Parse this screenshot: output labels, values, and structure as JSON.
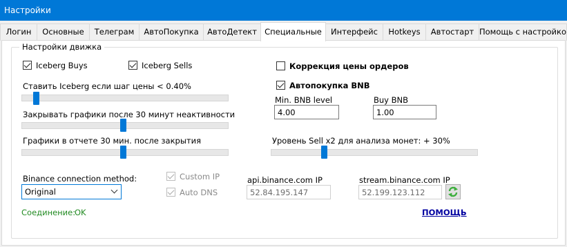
{
  "window": {
    "title": "Настройки"
  },
  "tabs": [
    {
      "label": "Логин"
    },
    {
      "label": "Основные"
    },
    {
      "label": "Телеграм"
    },
    {
      "label": "АвтоПокупка"
    },
    {
      "label": "АвтоДетект"
    },
    {
      "label": "Специальные"
    },
    {
      "label": "Интерфейс"
    },
    {
      "label": "Hotkeys"
    },
    {
      "label": "Автостарт"
    },
    {
      "label": "Помощь с настройкой"
    }
  ],
  "active_tab": "Специальные",
  "engine": {
    "group_title": "Настройки движка",
    "iceberg_buys": {
      "label": "Iceberg Buys",
      "checked": true
    },
    "iceberg_sells": {
      "label": "Iceberg Sells",
      "checked": true
    },
    "slider_iceberg": {
      "label": "Ставить Iceberg если шаг цены < 0.40%",
      "value_fraction": 0.06
    },
    "slider_close_charts": {
      "label": "Закрывать графики после 30 минут неактивности",
      "value_fraction": 0.49
    },
    "slider_report_charts": {
      "label": "Графики в отчете 30 мин. после закрытия",
      "value_fraction": 0.49
    },
    "price_correction": {
      "label": "Коррекция цены ордеров",
      "checked": false
    },
    "auto_buy_bnb": {
      "label": "Автопокупка BNB",
      "checked": true
    },
    "min_bnb": {
      "label": "Min. BNB level",
      "value": "4.00"
    },
    "buy_bnb": {
      "label": "Buy BNB",
      "value": "1.00"
    },
    "slider_sell_level": {
      "label": "Уровень Sell x2 для анализа монет: + 30%",
      "value_fraction": 0.25
    },
    "connection": {
      "label": "Binance connection method:",
      "selected": "Original",
      "custom_ip": {
        "label": "Custom IP",
        "checked": true
      },
      "auto_dns": {
        "label": "Auto DNS",
        "checked": true
      },
      "api_ip_label": "api.binance.com IP",
      "api_ip_value": "52.84.195.147",
      "stream_ip_label": "stream.binance.com IP",
      "stream_ip_value": "52.199.123.112"
    },
    "status": {
      "label": "Соединение:",
      "value": "OK"
    },
    "help_link": "ПОМОЩЬ"
  },
  "colors": {
    "titlebar": "#0078d7",
    "slider_thumb": "#0078d7",
    "status_ok": "#228b22",
    "help_link": "#0000a0",
    "refresh_icon": "#3cae3c"
  },
  "icons": {
    "refresh": "refresh-arrows-icon"
  }
}
